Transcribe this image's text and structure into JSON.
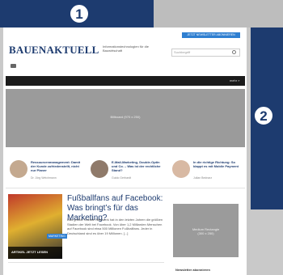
{
  "callouts": {
    "one": "1",
    "two": "2"
  },
  "site": {
    "logo_part1": "BAUEN",
    "logo_part2": "AKTUELL",
    "tagline": "Informationstechnologien für die Bauwirtschaft",
    "newsletter_button": "JETZT NEWSLETTER ABONNIEREN",
    "search_placeholder": "Suchbegriff",
    "nav_more": "mehr »"
  },
  "ads": {
    "billboard": "Billboard (970 x 250)",
    "medium_rectangle_line1": "Medium Rectangle",
    "medium_rectangle_line2": "(300 x 250)"
  },
  "teasers": [
    {
      "title": "Ressourcenmanagement: Damit der Kunde zufriedenstellt, nicht nur Planer",
      "author": "Dr. Jörg Weichmann"
    },
    {
      "title": "E-Mail-Marketing, Double-Optin und Co. – Was ist der rechtliche Stand?",
      "author": "Guido Gerhardt"
    },
    {
      "title": "In die richtige Richtung: So klappt es mit Mobile Payment",
      "author": "Julian Bednarz"
    }
  ],
  "article": {
    "title": "Fußballfans auf Facebook: Was bringt’s für das Marketing?",
    "excerpt": "Das größte Soziale Netzwerk hat in den letzten Jahren die größten Stadien der Welt bei Facebook. Von über 1,2 Milliarden Menschen auf Facebook sind etwa 500 Millionen Fußballfans. Jeder in Deutschland sind es über 19 Millionen. [...]",
    "tag": "MARKETING",
    "image_label": "ARTIKEL JETZT LESEN"
  },
  "sidebar": {
    "newsletter_label": "Newsletter abonnieren"
  },
  "colors": {
    "primary": "#1d3b6f",
    "accent": "#2f7fd1",
    "ad_grey": "#9b9b9b"
  }
}
